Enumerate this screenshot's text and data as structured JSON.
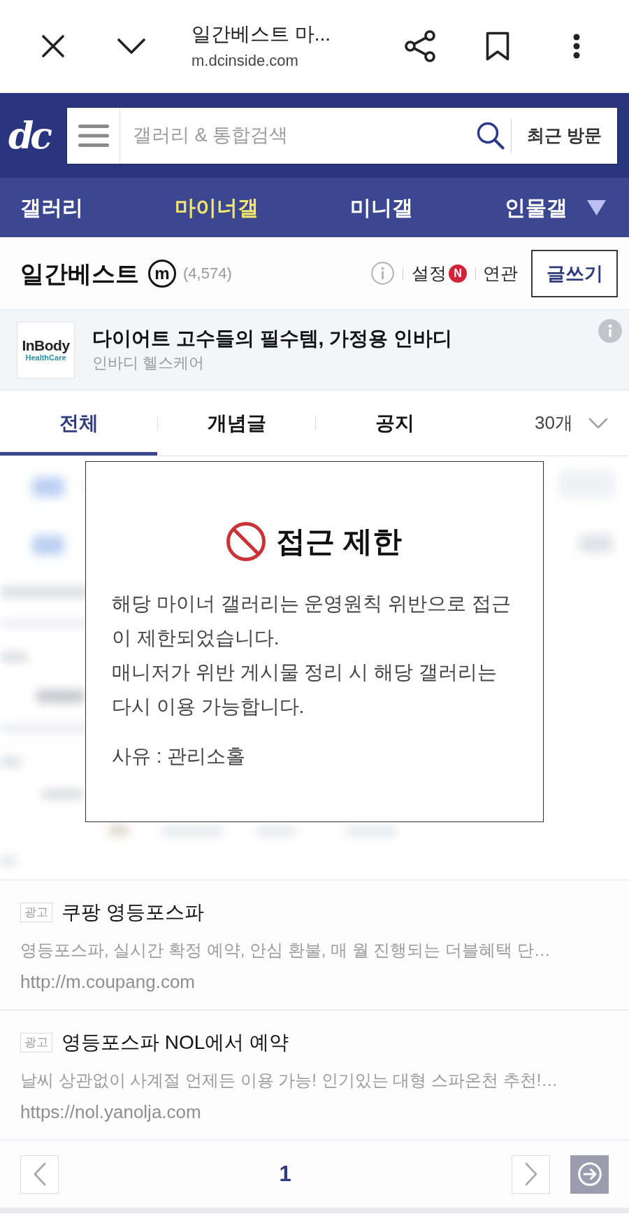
{
  "browser_bar": {
    "title": "일간베스트 마...",
    "url": "m.dcinside.com"
  },
  "site_header": {
    "logo": "dc",
    "search": {
      "placeholder": "갤러리 & 통합검색"
    },
    "recent_button": "최근 방문"
  },
  "nav": {
    "items": [
      {
        "label": "갤러리",
        "selected": false
      },
      {
        "label": "마이너갤",
        "selected": true
      },
      {
        "label": "미니갤",
        "selected": false
      },
      {
        "label": "인물갤",
        "selected": false
      }
    ]
  },
  "gallery_header": {
    "title": "일간베스트",
    "type_mark": "m",
    "post_count": "(4,574)",
    "links": [
      {
        "label": "설정",
        "badge": "N"
      },
      {
        "label": "연관"
      }
    ],
    "write_button": "글쓰기"
  },
  "banner_ad": {
    "logo": {
      "name": "InBody",
      "tagline": "HealthCare"
    },
    "title": "다이어트 고수들의 필수템, 가정용 인바디",
    "advertiser": "인바디 헬스케어"
  },
  "tabs": {
    "items": [
      {
        "label": "전체",
        "selected": true
      },
      {
        "label": "개념글",
        "selected": false
      },
      {
        "label": "공지",
        "selected": false
      }
    ],
    "page_size": "30개"
  },
  "notice_modal": {
    "title": "접근 제한",
    "paragraphs": [
      "해당 마이너 갤러리는 운영원칙 위반으로 접근이 제한되었습니다.",
      "매니저가 위반 게시물 정리 시 해당 갤러리는 다시 이용 가능합니다."
    ],
    "reason": "사유 : 관리소홀"
  },
  "ads": [
    {
      "tag": "광고",
      "title": "쿠팡 영등포스파",
      "description": "영등포스파, 실시간 확정 예약, 안심 환불, 매 월 진행되는 더블혜택 단…",
      "url": "http://m.coupang.com"
    },
    {
      "tag": "광고",
      "title": "영등포스파 NOL에서 예약",
      "description": "날씨 상관없이 사계절 언제든 이용 가능! 인기있는 대형 스파온천 추천!…",
      "url": "https://nol.yanolja.com"
    }
  ],
  "pagination": {
    "current": "1"
  }
}
